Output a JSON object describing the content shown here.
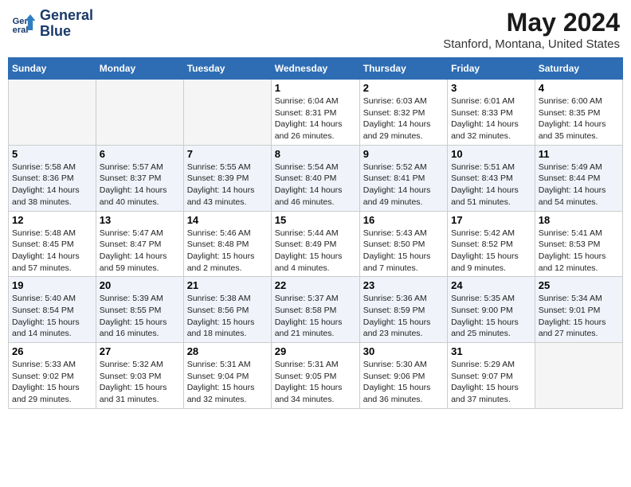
{
  "header": {
    "logo_line1": "General",
    "logo_line2": "Blue",
    "title": "May 2024",
    "subtitle": "Stanford, Montana, United States"
  },
  "days_of_week": [
    "Sunday",
    "Monday",
    "Tuesday",
    "Wednesday",
    "Thursday",
    "Friday",
    "Saturday"
  ],
  "weeks": [
    [
      {
        "day": "",
        "info": ""
      },
      {
        "day": "",
        "info": ""
      },
      {
        "day": "",
        "info": ""
      },
      {
        "day": "1",
        "info": "Sunrise: 6:04 AM\nSunset: 8:31 PM\nDaylight: 14 hours and 26 minutes."
      },
      {
        "day": "2",
        "info": "Sunrise: 6:03 AM\nSunset: 8:32 PM\nDaylight: 14 hours and 29 minutes."
      },
      {
        "day": "3",
        "info": "Sunrise: 6:01 AM\nSunset: 8:33 PM\nDaylight: 14 hours and 32 minutes."
      },
      {
        "day": "4",
        "info": "Sunrise: 6:00 AM\nSunset: 8:35 PM\nDaylight: 14 hours and 35 minutes."
      }
    ],
    [
      {
        "day": "5",
        "info": "Sunrise: 5:58 AM\nSunset: 8:36 PM\nDaylight: 14 hours and 38 minutes."
      },
      {
        "day": "6",
        "info": "Sunrise: 5:57 AM\nSunset: 8:37 PM\nDaylight: 14 hours and 40 minutes."
      },
      {
        "day": "7",
        "info": "Sunrise: 5:55 AM\nSunset: 8:39 PM\nDaylight: 14 hours and 43 minutes."
      },
      {
        "day": "8",
        "info": "Sunrise: 5:54 AM\nSunset: 8:40 PM\nDaylight: 14 hours and 46 minutes."
      },
      {
        "day": "9",
        "info": "Sunrise: 5:52 AM\nSunset: 8:41 PM\nDaylight: 14 hours and 49 minutes."
      },
      {
        "day": "10",
        "info": "Sunrise: 5:51 AM\nSunset: 8:43 PM\nDaylight: 14 hours and 51 minutes."
      },
      {
        "day": "11",
        "info": "Sunrise: 5:49 AM\nSunset: 8:44 PM\nDaylight: 14 hours and 54 minutes."
      }
    ],
    [
      {
        "day": "12",
        "info": "Sunrise: 5:48 AM\nSunset: 8:45 PM\nDaylight: 14 hours and 57 minutes."
      },
      {
        "day": "13",
        "info": "Sunrise: 5:47 AM\nSunset: 8:47 PM\nDaylight: 14 hours and 59 minutes."
      },
      {
        "day": "14",
        "info": "Sunrise: 5:46 AM\nSunset: 8:48 PM\nDaylight: 15 hours and 2 minutes."
      },
      {
        "day": "15",
        "info": "Sunrise: 5:44 AM\nSunset: 8:49 PM\nDaylight: 15 hours and 4 minutes."
      },
      {
        "day": "16",
        "info": "Sunrise: 5:43 AM\nSunset: 8:50 PM\nDaylight: 15 hours and 7 minutes."
      },
      {
        "day": "17",
        "info": "Sunrise: 5:42 AM\nSunset: 8:52 PM\nDaylight: 15 hours and 9 minutes."
      },
      {
        "day": "18",
        "info": "Sunrise: 5:41 AM\nSunset: 8:53 PM\nDaylight: 15 hours and 12 minutes."
      }
    ],
    [
      {
        "day": "19",
        "info": "Sunrise: 5:40 AM\nSunset: 8:54 PM\nDaylight: 15 hours and 14 minutes."
      },
      {
        "day": "20",
        "info": "Sunrise: 5:39 AM\nSunset: 8:55 PM\nDaylight: 15 hours and 16 minutes."
      },
      {
        "day": "21",
        "info": "Sunrise: 5:38 AM\nSunset: 8:56 PM\nDaylight: 15 hours and 18 minutes."
      },
      {
        "day": "22",
        "info": "Sunrise: 5:37 AM\nSunset: 8:58 PM\nDaylight: 15 hours and 21 minutes."
      },
      {
        "day": "23",
        "info": "Sunrise: 5:36 AM\nSunset: 8:59 PM\nDaylight: 15 hours and 23 minutes."
      },
      {
        "day": "24",
        "info": "Sunrise: 5:35 AM\nSunset: 9:00 PM\nDaylight: 15 hours and 25 minutes."
      },
      {
        "day": "25",
        "info": "Sunrise: 5:34 AM\nSunset: 9:01 PM\nDaylight: 15 hours and 27 minutes."
      }
    ],
    [
      {
        "day": "26",
        "info": "Sunrise: 5:33 AM\nSunset: 9:02 PM\nDaylight: 15 hours and 29 minutes."
      },
      {
        "day": "27",
        "info": "Sunrise: 5:32 AM\nSunset: 9:03 PM\nDaylight: 15 hours and 31 minutes."
      },
      {
        "day": "28",
        "info": "Sunrise: 5:31 AM\nSunset: 9:04 PM\nDaylight: 15 hours and 32 minutes."
      },
      {
        "day": "29",
        "info": "Sunrise: 5:31 AM\nSunset: 9:05 PM\nDaylight: 15 hours and 34 minutes."
      },
      {
        "day": "30",
        "info": "Sunrise: 5:30 AM\nSunset: 9:06 PM\nDaylight: 15 hours and 36 minutes."
      },
      {
        "day": "31",
        "info": "Sunrise: 5:29 AM\nSunset: 9:07 PM\nDaylight: 15 hours and 37 minutes."
      },
      {
        "day": "",
        "info": ""
      }
    ]
  ]
}
